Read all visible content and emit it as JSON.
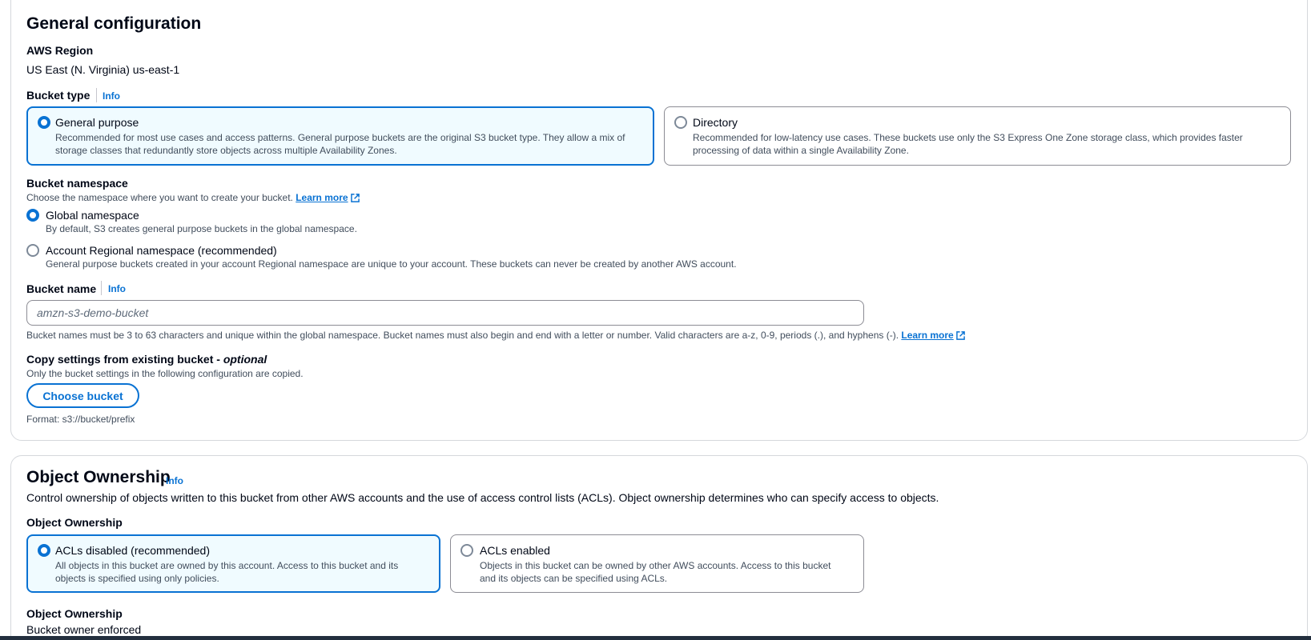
{
  "general": {
    "title": "General configuration",
    "region_label": "AWS Region",
    "region_value": "US East (N. Virginia) us-east-1",
    "bucket_type": {
      "label": "Bucket type",
      "info": "Info",
      "options": [
        {
          "title": "General purpose",
          "desc_line1": "Recommended for most use cases and access patterns. General purpose buckets are the original S3 bucket type. They allow a mix of",
          "desc_line2": "storage classes that redundantly store objects across multiple Availability Zones.",
          "selected": true
        },
        {
          "title": "Directory",
          "desc_line1": "Recommended for low-latency use cases. These buckets use only the S3 Express One Zone storage class, which provides faster",
          "desc_line2": "processing of data within a single Availability Zone.",
          "selected": false
        }
      ]
    },
    "namespace": {
      "label": "Bucket namespace",
      "description": "Choose the namespace where you want to create your bucket.",
      "learn_more": "Learn more",
      "options": [
        {
          "title": "Global namespace",
          "desc": "By default, S3 creates general purpose buckets in the global namespace.",
          "selected": true
        },
        {
          "title": "Account Regional namespace (recommended)",
          "desc": "General purpose buckets created in your account Regional namespace are unique to your account. These buckets can never be created by another AWS account.",
          "selected": false
        }
      ]
    },
    "bucket_name": {
      "label": "Bucket name",
      "info": "Info",
      "value": "",
      "placeholder": "amzn-s3-demo-bucket",
      "hint": "Bucket names must be 3 to 63 characters and unique within the global namespace. Bucket names must also begin and end with a letter or number. Valid characters are a-z, 0-9, periods (.), and hyphens (-).",
      "learn_more": "Learn more"
    },
    "copy_settings": {
      "label": "Copy settings from existing bucket - ",
      "label_optional": "optional",
      "description": "Only the bucket settings in the following configuration are copied.",
      "button": "Choose bucket",
      "format": "Format: s3://bucket/prefix"
    }
  },
  "ownership": {
    "title": "Object Ownership",
    "info": "Info",
    "description": "Control ownership of objects written to this bucket from other AWS accounts and the use of access control lists (ACLs). Object ownership determines who can specify access to objects.",
    "field_label": "Object Ownership",
    "options": [
      {
        "title": "ACLs disabled (recommended)",
        "desc_line1": "All objects in this bucket are owned by this account. Access to this bucket and its",
        "desc_line2": "objects is specified using only policies.",
        "selected": true
      },
      {
        "title": "ACLs enabled",
        "desc_line1": "Objects in this bucket can be owned by other AWS accounts. Access to this bucket",
        "desc_line2": "and its objects can be specified using ACLs.",
        "selected": false
      }
    ],
    "result_label": "Object Ownership",
    "result_value": "Bucket owner enforced"
  },
  "colors": {
    "accent": "#0972d3",
    "selected_bg": "#f0fbff",
    "text": "#000716",
    "secondary_text": "#414d5c"
  }
}
